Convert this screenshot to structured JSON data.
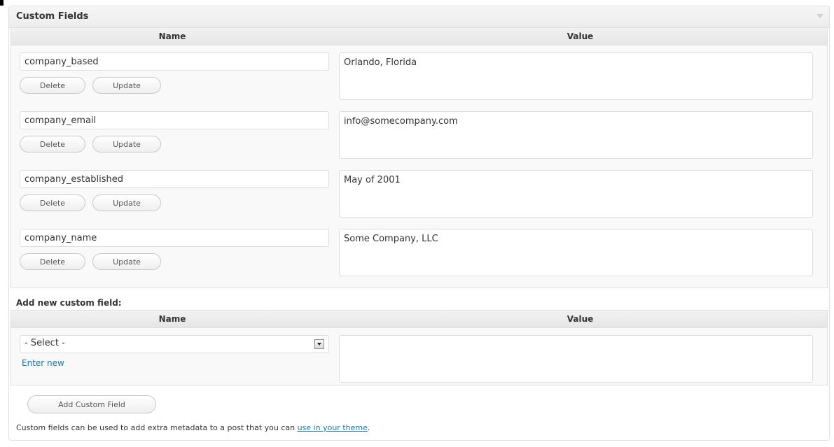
{
  "box": {
    "title": "Custom Fields"
  },
  "existing": {
    "headers": {
      "name": "Name",
      "value": "Value"
    },
    "rows": [
      {
        "key": "company_based",
        "value": "Orlando, Florida"
      },
      {
        "key": "company_email",
        "value": "info@somecompany.com"
      },
      {
        "key": "company_established",
        "value": "May of 2001"
      },
      {
        "key": "company_name",
        "value": "Some Company, LLC"
      }
    ],
    "delete_label": "Delete",
    "update_label": "Update"
  },
  "add_new": {
    "label": "Add new custom field:",
    "headers": {
      "name": "Name",
      "value": "Value"
    },
    "select_value": "- Select -",
    "enter_new_label": "Enter new",
    "value": "",
    "add_button_label": "Add Custom Field"
  },
  "footer": {
    "note_text": "Custom fields can be used to add extra metadata to a post that you can ",
    "link_text": "use in your theme",
    "note_end": "."
  }
}
